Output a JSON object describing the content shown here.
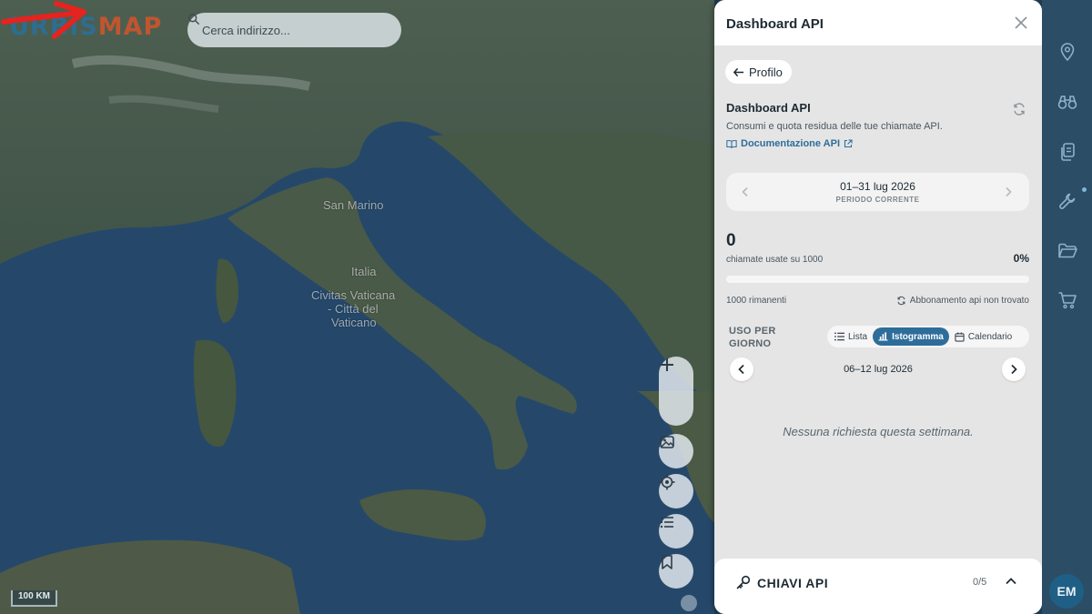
{
  "app": {
    "logo_part1": "URBIS",
    "logo_part2": "MAP"
  },
  "search": {
    "placeholder": "Cerca indirizzo..."
  },
  "map": {
    "labels": [
      "San Marino",
      "Italia",
      "Civitas Vaticana",
      "- Città del",
      "Vaticano"
    ],
    "scale": "100 KM",
    "controls": [
      "zoom-in-icon",
      "zoom-out-icon",
      "image-icon",
      "locate-icon",
      "list-icon",
      "bookmark-icon"
    ]
  },
  "panel": {
    "title": "Dashboard API",
    "back_label": "Profilo",
    "section_title": "Dashboard API",
    "section_subtitle": "Consumi e quota residua delle tue chiamate API.",
    "doc_link": "Documentazione API",
    "period": {
      "range": "01–31 lug 2026",
      "label": "PERIODO CORRENTE"
    },
    "usage": {
      "used": "0",
      "label": "chiamate usate su 1000",
      "percent": "0%",
      "fraction": 0,
      "remaining": "1000 rimanenti",
      "status": "Abbonamento api non trovato"
    },
    "daily": {
      "label": "USO PER GIORNO",
      "views": [
        "Lista",
        "Istogramma",
        "Calendario"
      ],
      "active_view": "Istogramma",
      "week": "06–12 lug 2026",
      "empty": "Nessuna richiesta questa settimana."
    },
    "keys": {
      "label": "CHIAVI API",
      "count": "0/5"
    }
  },
  "rail": {
    "icons": [
      "location-pin-icon",
      "binoculars-icon",
      "documents-icon",
      "wrench-icon",
      "folder-icon",
      "cart-icon"
    ],
    "avatar": "EM"
  },
  "colors": {
    "accent": "#2e6d9a",
    "logo_blue": "#2e6d91",
    "logo_orange": "#c0552f",
    "annotation_arrow": "#e5231f"
  }
}
